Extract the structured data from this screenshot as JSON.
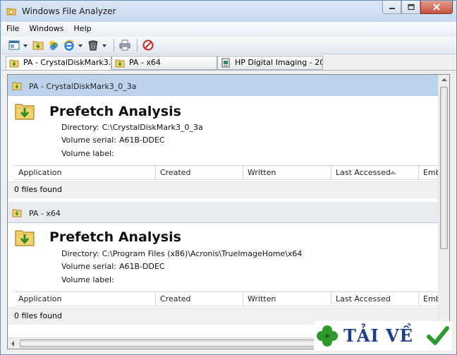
{
  "window": {
    "title": "Windows File Analyzer"
  },
  "menu": {
    "items": [
      "File",
      "Windows",
      "Help"
    ]
  },
  "toolbar": {
    "buttons": [
      "open-icon",
      "prefetch-icon",
      "colors-icon",
      "web-icon",
      "trash-icon",
      "print-icon",
      "stop-icon"
    ]
  },
  "tabs": [
    {
      "label": "PA - CrystalDiskMark3..."
    },
    {
      "label": "PA - x64"
    },
    {
      "label": "HP Digital Imaging - 20..."
    }
  ],
  "sections": [
    {
      "header": "PA - CrystalDiskMark3_0_3a",
      "heading": "Prefetch Analysis",
      "directory_label": "Directory:",
      "directory_value": "C:\\CrystalDiskMark3_0_3a",
      "serial_label": "Volume serial:",
      "serial_value": "A61B-DDEC",
      "vlabel_label": "Volume label:",
      "vlabel_value": "",
      "files_found": "0 files found"
    },
    {
      "header": "PA - x64",
      "heading": "Prefetch Analysis",
      "directory_label": "Directory:",
      "directory_value": "C:\\Program Files (x86)\\Acronis\\TrueImageHome\\x64",
      "serial_label": "Volume serial:",
      "serial_value": "A61B-DDEC",
      "vlabel_label": "Volume label:",
      "vlabel_value": "",
      "files_found": "0 files found"
    }
  ],
  "columns": [
    "Application",
    "Created",
    "Written",
    "Last Accessed",
    "Emb"
  ],
  "sort_column": "Last Accessed",
  "watermark": {
    "text": "TẢI VỀ"
  },
  "colors": {
    "active_header": "#bdd3ec",
    "watermark_text": "#1c3d8c",
    "watermark_clover": "#2e9a2e"
  }
}
